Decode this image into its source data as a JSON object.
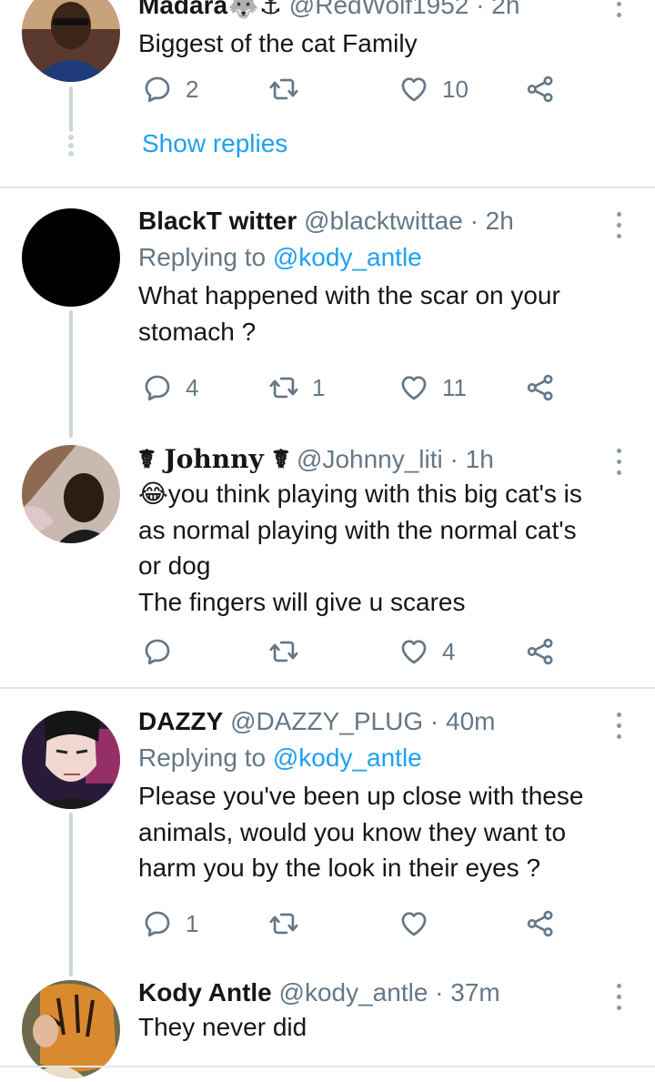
{
  "tweets": [
    {
      "name": "Madara🐺⚓",
      "handle": "@RedWolf1952",
      "time": "· 2h",
      "text": "Biggest of the cat Family",
      "replies": "2",
      "retweets": "",
      "likes": "10",
      "show_replies": "Show replies"
    },
    {
      "name": "BlackT witter",
      "handle": "@blacktwittae",
      "time": "· 2h",
      "replying_prefix": "Replying to",
      "replying_to": "@kody_antle",
      "text": "What happened with the scar on your stomach ?",
      "replies": "4",
      "retweets": "1",
      "likes": "11"
    },
    {
      "name": "☤ Johnny ☤",
      "handle": "@Johnny_liti",
      "time": "· 1h",
      "text_lines": [
        "😂you think playing with this big cat's is",
        "as normal playing with the normal cat's",
        "or dog",
        "The fingers will give u scares"
      ],
      "replies": "",
      "retweets": "",
      "likes": "4"
    },
    {
      "name": "DAZZY",
      "handle": "@DAZZY_PLUG",
      "time": "· 40m",
      "replying_prefix": "Replying to",
      "replying_to": "@kody_antle",
      "text": "Please you've been up close with these animals, would you know they want to harm you by the look in their eyes ?",
      "replies": "1",
      "retweets": "",
      "likes": ""
    },
    {
      "name": "Kody Antle",
      "handle": "@kody_antle",
      "time": "· 37m",
      "text": "They never did"
    }
  ],
  "icons": {
    "reply": "reply-icon",
    "retweet": "retweet-icon",
    "like": "heart-icon",
    "share": "share-icon",
    "more": "more-vertical-icon"
  },
  "colors": {
    "accent": "#1da1f2",
    "secondary_text": "#657786",
    "divider": "#e1e8ed",
    "thread_line": "#ccd6dd"
  }
}
